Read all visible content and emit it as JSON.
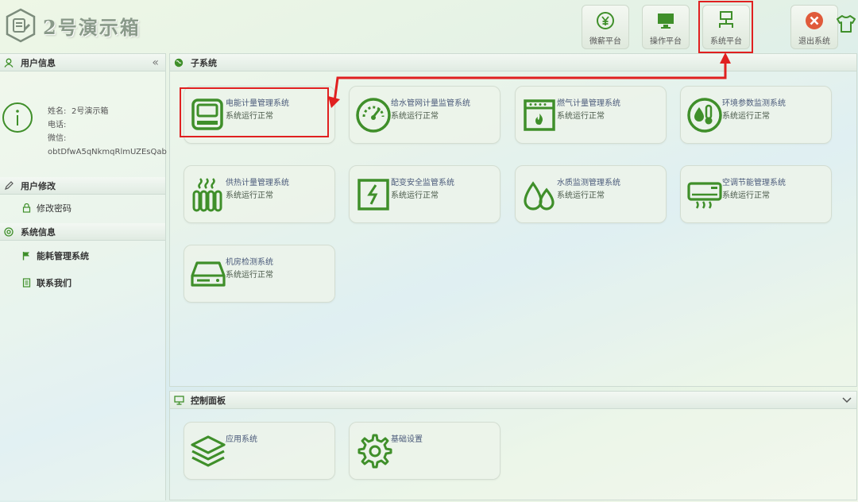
{
  "header": {
    "title": "2号演示箱",
    "nav": [
      {
        "label": "微薪平台",
        "icon": "yen-circle-icon"
      },
      {
        "label": "操作平台",
        "icon": "monitor-icon"
      },
      {
        "label": "系统平台",
        "icon": "network-icon",
        "active": true
      },
      {
        "label": "退出系统",
        "icon": "close-circle-icon"
      }
    ]
  },
  "sidebar": {
    "user_info": {
      "title": "用户信息",
      "name_label": "姓名:",
      "name_value": "2号演示箱",
      "phone_label": "电话:",
      "phone_value": "",
      "wechat_label": "微信:",
      "wechat_value": "obtDfwA5qNkmqRlmUZEsQab"
    },
    "user_edit": {
      "title": "用户修改",
      "items": [
        {
          "label": "修改密码",
          "icon": "lock-icon"
        }
      ]
    },
    "system_info": {
      "title": "系统信息",
      "items": [
        {
          "label": "能耗管理系统",
          "icon": "flag-icon"
        },
        {
          "label": "联系我们",
          "icon": "document-icon"
        }
      ]
    }
  },
  "subsystems": {
    "title": "子系统",
    "tiles": [
      {
        "name": "电能计量管理系统",
        "status": "系统运行正常",
        "icon": "electric-meter-icon"
      },
      {
        "name": "给水管网计量监管系统",
        "status": "系统运行正常",
        "icon": "gauge-icon"
      },
      {
        "name": "燃气计量管理系统",
        "status": "系统运行正常",
        "icon": "gas-stove-icon"
      },
      {
        "name": "环境参数监测系统",
        "status": "系统运行正常",
        "icon": "thermometer-drop-icon"
      },
      {
        "name": "供热计量管理系统",
        "status": "系统运行正常",
        "icon": "radiator-icon"
      },
      {
        "name": "配变安全监管系统",
        "status": "系统运行正常",
        "icon": "power-box-icon"
      },
      {
        "name": "水质监测管理系统",
        "status": "系统运行正常",
        "icon": "water-drops-icon"
      },
      {
        "name": "空调节能管理系统",
        "status": "系统运行正常",
        "icon": "air-conditioner-icon"
      },
      {
        "name": "机房检测系统",
        "status": "系统运行正常",
        "icon": "server-drive-icon"
      }
    ]
  },
  "control_panel": {
    "title": "控制面板",
    "tiles": [
      {
        "name": "应用系统",
        "icon": "layers-icon"
      },
      {
        "name": "基础设置",
        "icon": "cog-icon"
      }
    ]
  },
  "colors": {
    "icon_green": "#3f8f2a",
    "annotation_red": "#e02020"
  }
}
